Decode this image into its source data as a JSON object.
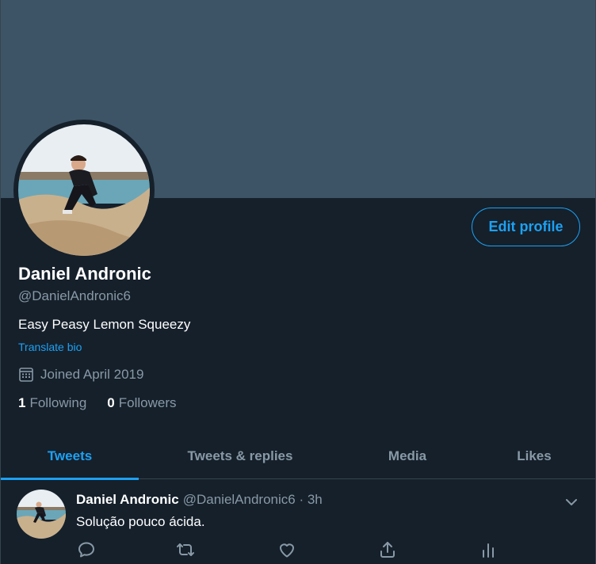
{
  "profile": {
    "name": "Daniel Andronic",
    "handle": "@DanielAndronic6",
    "bio": "Easy Peasy Lemon Squeezy",
    "translate_label": "Translate bio",
    "joined": "Joined April 2019",
    "following_count": "1",
    "following_label": "Following",
    "followers_count": "0",
    "followers_label": "Followers",
    "edit_label": "Edit profile"
  },
  "tabs": [
    {
      "label": "Tweets",
      "active": true
    },
    {
      "label": "Tweets & replies",
      "active": false
    },
    {
      "label": "Media",
      "active": false
    },
    {
      "label": "Likes",
      "active": false
    }
  ],
  "tweet": {
    "name": "Daniel Andronic",
    "handle": "@DanielAndronic6",
    "time": "· 3h",
    "text": "Solução pouco ácida."
  },
  "icons": {
    "calendar": "calendar-icon",
    "chevron": "chevron-down-icon",
    "reply": "reply-icon",
    "retweet": "retweet-icon",
    "like": "like-icon",
    "share": "share-icon",
    "analytics": "analytics-icon"
  },
  "colors": {
    "background": "#15202b",
    "banner": "#3d5466",
    "accent": "#1da1f2",
    "secondary_text": "#8899a6",
    "divider": "#38444d"
  }
}
